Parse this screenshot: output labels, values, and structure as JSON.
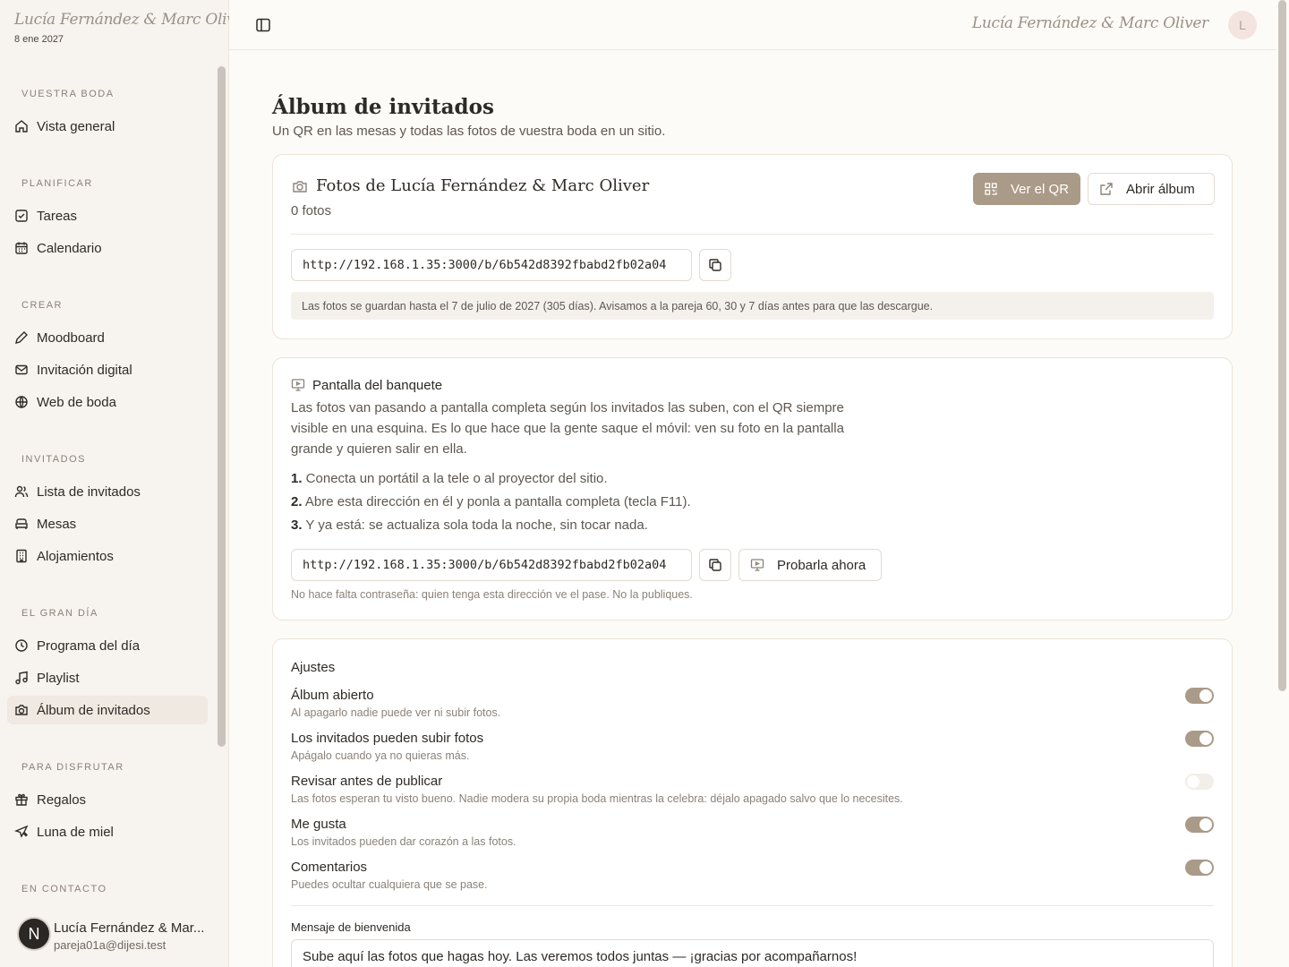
{
  "brand": {
    "couple": "Lucía Fernández & Marc Oliver",
    "date": "8 ene 2027"
  },
  "sidebar": {
    "sections": [
      {
        "label": "VUESTRA BODA",
        "items": [
          {
            "label": "Vista general",
            "icon": "home-icon"
          }
        ]
      },
      {
        "label": "PLANIFICAR",
        "items": [
          {
            "label": "Tareas",
            "icon": "checkbox-icon"
          },
          {
            "label": "Calendario",
            "icon": "calendar-icon"
          }
        ]
      },
      {
        "label": "CREAR",
        "items": [
          {
            "label": "Moodboard",
            "icon": "pencil-icon"
          },
          {
            "label": "Invitación digital",
            "icon": "mail-icon"
          },
          {
            "label": "Web de boda",
            "icon": "globe-icon"
          }
        ]
      },
      {
        "label": "INVITADOS",
        "items": [
          {
            "label": "Lista de invitados",
            "icon": "users-icon"
          },
          {
            "label": "Mesas",
            "icon": "sofa-icon"
          },
          {
            "label": "Alojamientos",
            "icon": "building-icon"
          }
        ]
      },
      {
        "label": "EL GRAN DÍA",
        "items": [
          {
            "label": "Programa del día",
            "icon": "clock-icon"
          },
          {
            "label": "Playlist",
            "icon": "music-icon"
          },
          {
            "label": "Álbum de invitados",
            "icon": "camera-icon",
            "active": true
          }
        ]
      },
      {
        "label": "PARA DISFRUTAR",
        "items": [
          {
            "label": "Regalos",
            "icon": "gift-icon"
          },
          {
            "label": "Luna de miel",
            "icon": "plane-icon"
          }
        ]
      },
      {
        "label": "EN CONTACTO",
        "items": []
      }
    ],
    "user": {
      "initial": "N",
      "name": "Lucía Fernández & Mar...",
      "email": "pareja01a@dijesi.test"
    }
  },
  "topbar": {
    "couple": "Lucía Fernández & Marc Oliver",
    "avatar_initial": "L"
  },
  "page": {
    "title": "Álbum de invitados",
    "subtitle": "Un QR en las mesas y todas las fotos de vuestra boda en un sitio."
  },
  "album": {
    "title": "Fotos de Lucía Fernández & Marc Oliver",
    "count": "0 fotos",
    "qr_button": "Ver el QR",
    "open_button": "Abrir álbum",
    "url": "http://192.168.1.35:3000/b/6b542d8392fbabd2fb02a04",
    "retention_note": "Las fotos se guardan hasta el 7 de julio de 2027 (305 días). Avisamos a la pareja 60, 30 y 7 días antes para que las descargue."
  },
  "screen": {
    "title": "Pantalla del banquete",
    "description": "Las fotos van pasando a pantalla completa según los invitados las suben, con el QR siempre visible en una esquina. Es lo que hace que la gente saque el móvil: ven su foto en la pantalla grande y quieren salir en ella.",
    "steps": [
      {
        "num": "1.",
        "text": " Conecta un portátil a la tele o al proyector del sitio."
      },
      {
        "num": "2.",
        "text": " Abre esta dirección en él y ponla a pantalla completa (tecla F11)."
      },
      {
        "num": "3.",
        "text": " Y ya está: se actualiza sola toda la noche, sin tocar nada."
      }
    ],
    "url": "http://192.168.1.35:3000/b/6b542d8392fbabd2fb02a04",
    "try_button": "Probarla ahora",
    "note": "No hace falta contraseña: quien tenga esta dirección ve el pase. No la publiques."
  },
  "settings": {
    "title": "Ajustes",
    "items": [
      {
        "label": "Álbum abierto",
        "desc": "Al apagarlo nadie puede ver ni subir fotos.",
        "on": true
      },
      {
        "label": "Los invitados pueden subir fotos",
        "desc": "Apágalo cuando ya no quieras más.",
        "on": true
      },
      {
        "label": "Revisar antes de publicar",
        "desc": "Las fotos esperan tu visto bueno. Nadie modera su propia boda mientras la celebra: déjalo apagado salvo que lo necesites.",
        "on": false
      },
      {
        "label": "Me gusta",
        "desc": "Los invitados pueden dar corazón a las fotos.",
        "on": true
      },
      {
        "label": "Comentarios",
        "desc": "Puedes ocultar cualquiera que se pase.",
        "on": true
      }
    ],
    "welcome_label": "Mensaje de bienvenida",
    "welcome_value": "Sube aquí las fotos que hagas hoy. Las veremos todos juntas — ¡gracias por acompañarnos!"
  }
}
